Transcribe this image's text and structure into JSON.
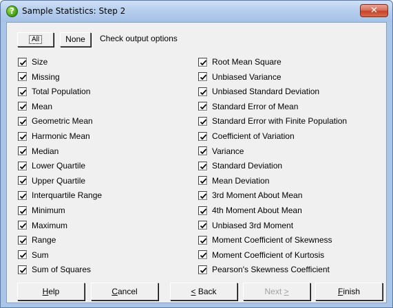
{
  "window": {
    "title": "Sample Statistics: Step 2",
    "icon": "help-question-icon",
    "close_glyph": "✕"
  },
  "top": {
    "all_label": "All",
    "none_label": "None",
    "hint": "Check output options"
  },
  "left_options": [
    {
      "label": "Size",
      "checked": true
    },
    {
      "label": "Missing",
      "checked": true
    },
    {
      "label": "Total Population",
      "checked": true
    },
    {
      "label": "Mean",
      "checked": true
    },
    {
      "label": "Geometric Mean",
      "checked": true
    },
    {
      "label": "Harmonic Mean",
      "checked": true
    },
    {
      "label": "Median",
      "checked": true
    },
    {
      "label": "Lower Quartile",
      "checked": true
    },
    {
      "label": "Upper Quartile",
      "checked": true
    },
    {
      "label": "Interquartile Range",
      "checked": true
    },
    {
      "label": "Minimum",
      "checked": true
    },
    {
      "label": "Maximum",
      "checked": true
    },
    {
      "label": "Range",
      "checked": true
    },
    {
      "label": "Sum",
      "checked": true
    },
    {
      "label": "Sum of Squares",
      "checked": true
    }
  ],
  "right_options": [
    {
      "label": "Root Mean Square",
      "checked": true
    },
    {
      "label": "Unbiased Variance",
      "checked": true
    },
    {
      "label": "Unbiased Standard Deviation",
      "checked": true
    },
    {
      "label": "Standard Error of Mean",
      "checked": true
    },
    {
      "label": "Standard Error with Finite Population",
      "checked": true
    },
    {
      "label": "Coefficient of Variation",
      "checked": true
    },
    {
      "label": "Variance",
      "checked": true
    },
    {
      "label": "Standard Deviation",
      "checked": true
    },
    {
      "label": "Mean Deviation",
      "checked": true
    },
    {
      "label": "3rd Moment About Mean",
      "checked": true
    },
    {
      "label": "4th Moment About Mean",
      "checked": true
    },
    {
      "label": "Unbiased 3rd Moment",
      "checked": true
    },
    {
      "label": "Moment Coefficient of Skewness",
      "checked": true
    },
    {
      "label": "Moment Coefficient of Kurtosis",
      "checked": true
    },
    {
      "label": "Pearson's Skewness Coefficient",
      "checked": true
    }
  ],
  "buttons": {
    "help": {
      "mnemonic": "H",
      "rest": "elp"
    },
    "cancel": {
      "mnemonic": "C",
      "rest": "ancel"
    },
    "back": {
      "prefix": "<",
      "rest": " Back",
      "mnemonic": "<"
    },
    "next": {
      "rest": "Next ",
      "suffix": ">",
      "disabled": true
    },
    "finish": {
      "mnemonic": "F",
      "rest": "inish"
    }
  }
}
